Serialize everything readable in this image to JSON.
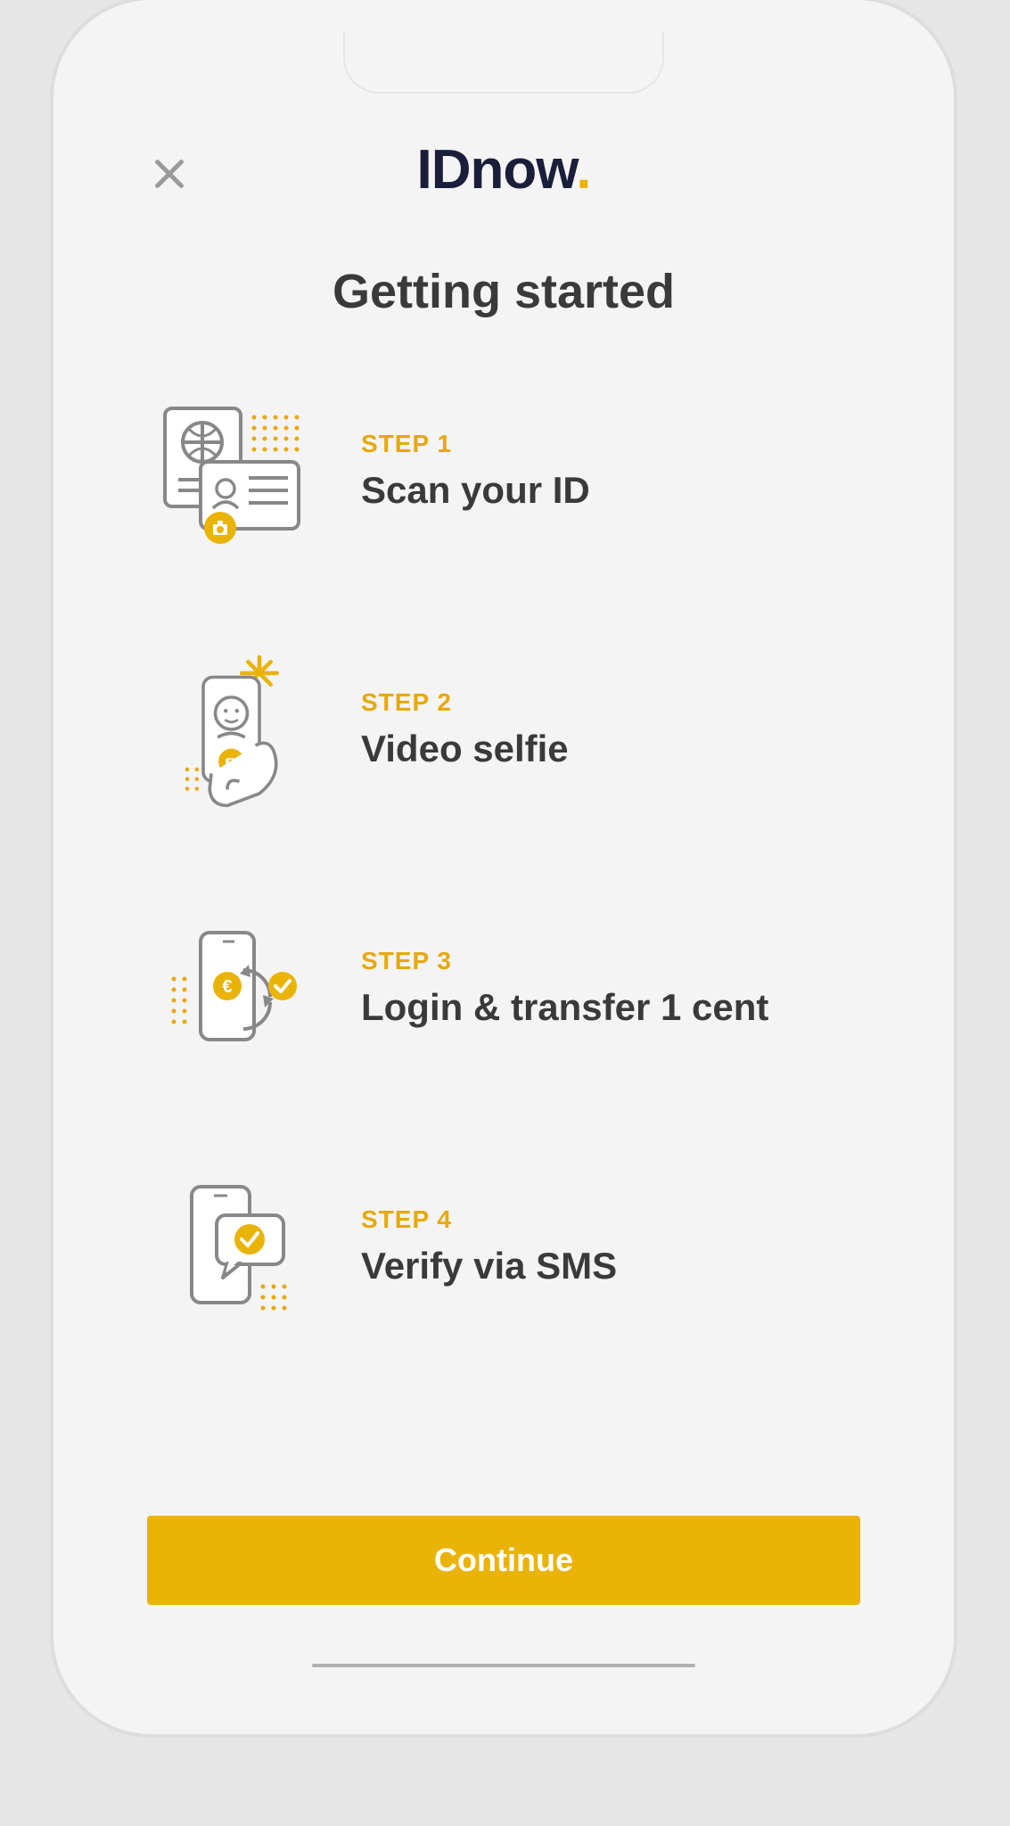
{
  "brand": {
    "name": "IDnow",
    "dot": "."
  },
  "header": {
    "title": "Getting started"
  },
  "steps": [
    {
      "label": "STEP 1",
      "title": "Scan your ID",
      "icon": "id-scan-icon"
    },
    {
      "label": "STEP 2",
      "title": "Video selfie",
      "icon": "video-selfie-icon"
    },
    {
      "label": "STEP 3",
      "title": "Login & transfer 1 cent",
      "icon": "transfer-icon"
    },
    {
      "label": "STEP 4",
      "title": "Verify via SMS",
      "icon": "sms-verify-icon"
    }
  ],
  "actions": {
    "continue": "Continue"
  },
  "colors": {
    "accent": "#eab308",
    "text": "#3a3a3a",
    "brand_dark": "#1a1e3a"
  }
}
